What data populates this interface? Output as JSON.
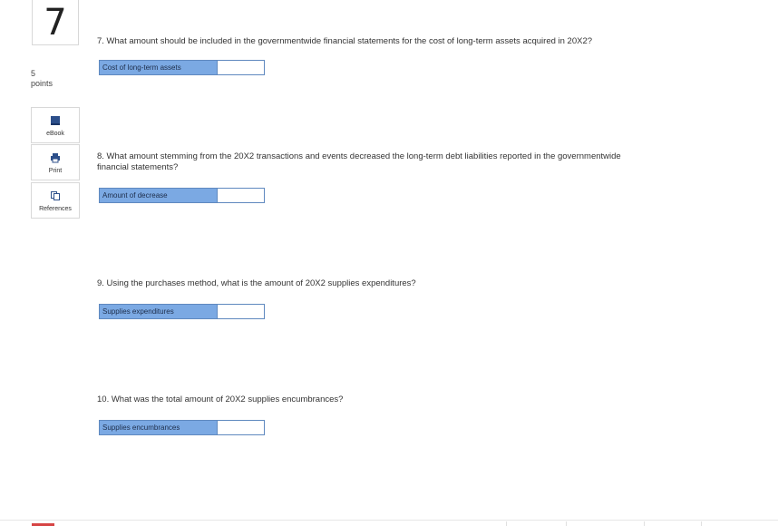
{
  "question_number": "7",
  "points": {
    "value": "5",
    "label": "points"
  },
  "tools": [
    {
      "label": "eBook",
      "icon": "book-icon"
    },
    {
      "label": "Print",
      "icon": "printer-icon"
    },
    {
      "label": "References",
      "icon": "references-icon"
    }
  ],
  "questions": [
    {
      "text": "7. What amount should be included in the governmentwide financial statements for the cost of long-term assets acquired in 20X2?",
      "answer_label": "Cost of long-term assets",
      "answer_value": ""
    },
    {
      "text": "8. What amount stemming from the 20X2 transactions and events decreased the long-term debt liabilities reported in the governmentwide financial statements?",
      "answer_label": "Amount of decrease",
      "answer_value": ""
    },
    {
      "text": "9. Using the purchases method, what is the amount of 20X2 supplies expenditures?",
      "answer_label": "Supplies expenditures",
      "answer_value": ""
    },
    {
      "text": "10. What was the total amount of 20X2 supplies encumbrances?",
      "answer_label": "Supplies encumbrances",
      "answer_value": ""
    }
  ],
  "colors": {
    "answer_label_bg": "#7ba9e3",
    "answer_border": "#5f89bf",
    "footer_accent": "#d64545"
  }
}
